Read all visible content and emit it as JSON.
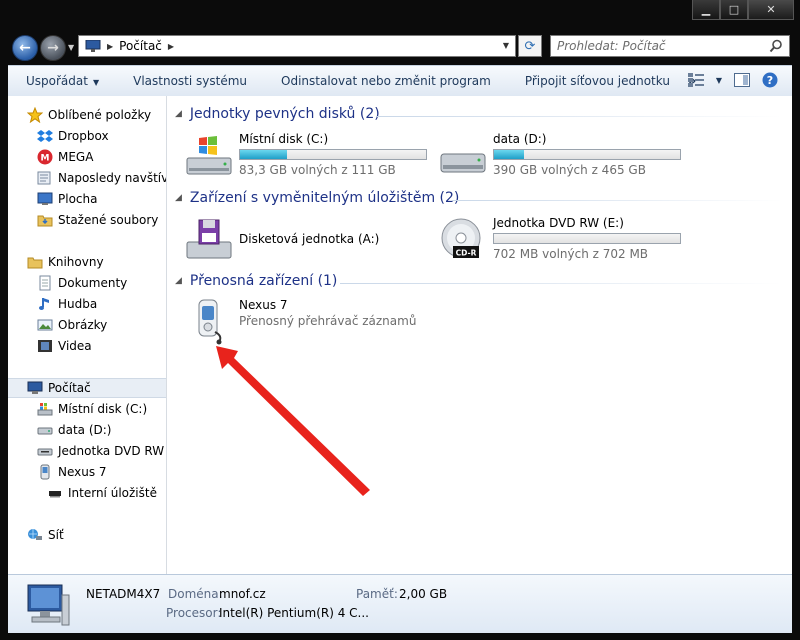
{
  "window": {
    "controls": {
      "minimize": "▁",
      "maximize": "□",
      "close": "✕"
    }
  },
  "address": {
    "location": "Počítač"
  },
  "search": {
    "placeholder": "Prohledat: Počítač"
  },
  "toolbar": {
    "organize": "Uspořádat",
    "system_properties": "Vlastnosti systému",
    "uninstall": "Odinstalovat nebo změnit program",
    "map_drive": "Připojit síťovou jednotku",
    "more": "»"
  },
  "sidebar": {
    "favorites": "Oblíbené položky",
    "dropbox": "Dropbox",
    "mega": "MEGA",
    "recent": "Naposledy navštíver",
    "desktop": "Plocha",
    "downloads": "Stažené soubory",
    "libraries": "Knihovny",
    "documents": "Dokumenty",
    "music": "Hudba",
    "pictures": "Obrázky",
    "videos": "Videa",
    "computer": "Počítač",
    "local_disk": "Místní disk (C:)",
    "data_disk": "data (D:)",
    "dvd": "Jednotka DVD RW (E",
    "nexus": "Nexus 7",
    "internal_storage": "Interní úložiště",
    "network": "Síť"
  },
  "groups": {
    "hdd": "Jednotky pevných disků (2)",
    "removable": "Zařízení s vyměnitelným úložištěm (2)",
    "portable": "Přenosná zařízení (1)"
  },
  "drives": {
    "c": {
      "name": "Místní disk (C:)",
      "free": "83,3 GB volných z 111 GB",
      "used_fraction": 0.25
    },
    "d": {
      "name": "data (D:)",
      "free": "390 GB volných z 465 GB",
      "used_fraction": 0.16
    },
    "floppy": {
      "name": "Disketová jednotka (A:)"
    },
    "dvd": {
      "name": "Jednotka DVD RW (E:)",
      "free": "702 MB volných z 702 MB",
      "used_fraction": 0.0,
      "badge": "CD-R"
    },
    "nexus": {
      "name": "Nexus 7",
      "type": "Přenosný přehrávač záznamů"
    }
  },
  "details": {
    "computer_name": "NETADM4X7",
    "domain_label": "Doména:",
    "domain_value": "mnof.cz",
    "memory_label": "Paměť:",
    "memory_value": "2,00 GB",
    "cpu_label": "Procesor:",
    "cpu_value": "Intel(R) Pentium(R) 4 C..."
  },
  "colors": {
    "accent": "#1e3287",
    "arrow": "#e8231c",
    "disk_fill": "#2aa7d0"
  }
}
